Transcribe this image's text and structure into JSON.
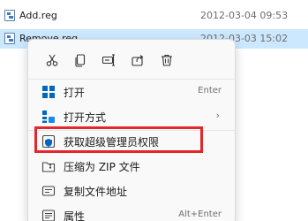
{
  "files": [
    {
      "name": "Add.reg",
      "date": "2012-03-04 09:53"
    },
    {
      "name": "Remove.reg",
      "date": "2012-03-03 15:02"
    }
  ],
  "quick_actions": [
    {
      "icon": "cut-icon"
    },
    {
      "icon": "copy-icon"
    },
    {
      "icon": "rename-icon"
    },
    {
      "icon": "share-icon"
    },
    {
      "icon": "delete-icon"
    }
  ],
  "menu": {
    "open": {
      "label": "打开",
      "shortcut": "Enter",
      "icon": "open-icon"
    },
    "open_with": {
      "label": "打开方式",
      "arrow": "›",
      "icon": "open-with-icon"
    },
    "super_admin": {
      "label": "获取超级管理员权限",
      "icon": "shield-icon"
    },
    "compress_zip": {
      "label": "压缩为 ZIP 文件",
      "icon": "zip-icon"
    },
    "copy_path": {
      "label": "复制文件地址",
      "icon": "copy-path-icon"
    },
    "properties": {
      "label": "属性",
      "shortcut": "Alt+Enter",
      "icon": "properties-icon"
    }
  },
  "colors": {
    "selection": "#cce8ff",
    "highlight_border": "#e5262a",
    "accent_blue": "#0067c0"
  }
}
